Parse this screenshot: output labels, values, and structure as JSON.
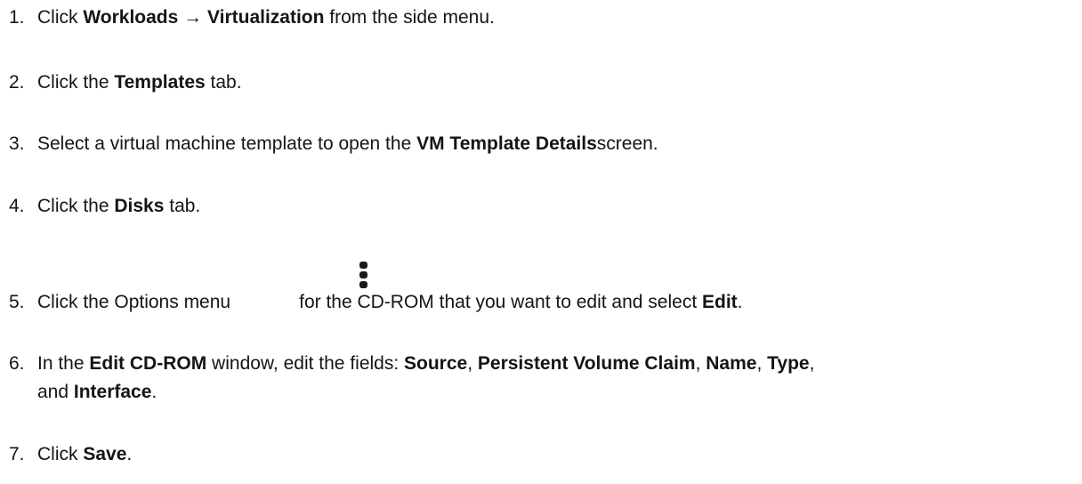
{
  "steps": [
    {
      "num": "1.",
      "parts": [
        "Click ",
        "Workloads",
        " → ",
        "Virtualization",
        " from the side menu."
      ]
    },
    {
      "num": "2.",
      "parts": [
        "Click the ",
        "Templates",
        " tab."
      ]
    },
    {
      "num": "3.",
      "parts": [
        "Select a virtual machine template to open the ",
        "VM Template Details",
        "screen."
      ]
    },
    {
      "num": "4.",
      "parts": [
        "Click the ",
        "Disks",
        " tab."
      ]
    },
    {
      "num": "5.",
      "parts": [
        "Click the Options menu",
        "for the CD-ROM that you want to edit and select ",
        "Edit",
        "."
      ]
    },
    {
      "num": "6.",
      "parts": [
        "In the ",
        "Edit CD-ROM",
        " window, edit the fields: ",
        "Source",
        ", ",
        "Persistent Volume Claim",
        ", ",
        "Name",
        ", ",
        "Type",
        ","
      ],
      "cont_parts": [
        "and ",
        "Interface",
        "."
      ]
    },
    {
      "num": "7.",
      "parts": [
        "Click ",
        "Save",
        "."
      ]
    }
  ],
  "icons": {
    "options_menu": "kebab-vertical-icon"
  }
}
